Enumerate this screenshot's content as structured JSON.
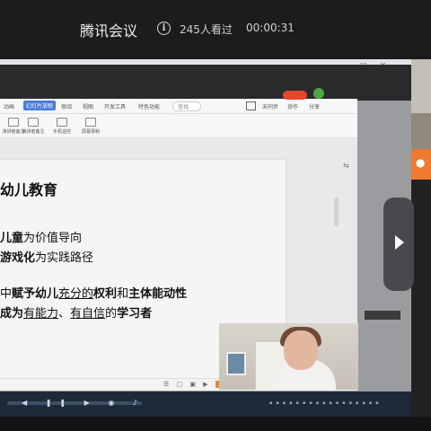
{
  "header": {
    "title": "腾讯会议",
    "viewers": "245人看过",
    "timer": "00:00:31"
  },
  "wps": {
    "tabs": [
      "动画",
      "幻灯片放映",
      "审阅",
      "视图",
      "开发工具",
      "特色功能",
      "查找"
    ],
    "active_tab": "幻灯片放映",
    "right_actions": [
      "未同步",
      "协作",
      "分享"
    ],
    "ribbon": [
      "演讲者备注",
      "演讲者备注",
      "手机遥控",
      "屏幕录制"
    ]
  },
  "slide": {
    "title": "幼儿教育",
    "lines": [
      {
        "bold": "儿童",
        "rest": "为价值导向"
      },
      {
        "bold": "游戏化",
        "rest": "为实践路径"
      },
      {
        "prefix": "中",
        "bold1": "赋予幼儿",
        "underline": "充分的",
        "bold2": "权利",
        "mid": "和",
        "bold3": "主体能动性"
      },
      {
        "bold1": "成为",
        "under1": "有能力",
        "sep": "、",
        "under2": "有自信",
        "mid": "的",
        "bold2": "学习者"
      }
    ]
  },
  "colors": {
    "active_tab": "#4a7bd8",
    "accent_orange": "#ef7a30",
    "taskbar": "#1d2a38"
  }
}
